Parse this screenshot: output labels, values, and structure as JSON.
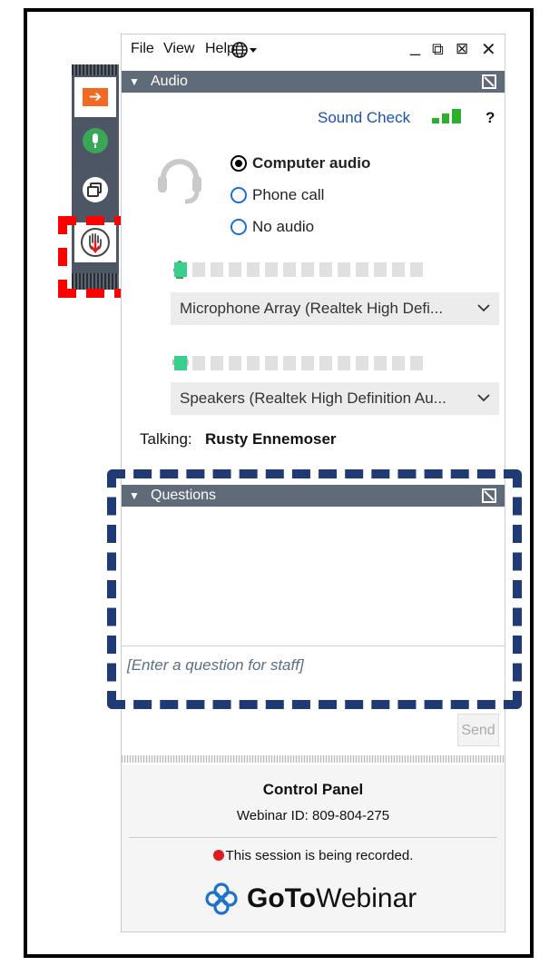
{
  "menu": {
    "file": "File",
    "view": "View",
    "help": "Help",
    "language_icon": "globe-icon",
    "minimize": "_",
    "restore": "⧉",
    "popout": "⊠",
    "close": "✕"
  },
  "grab_tab": {
    "buttons": [
      "arrow-icon",
      "microphone-icon",
      "screen-icon",
      "raise-hand-icon"
    ]
  },
  "audio": {
    "header": "Audio",
    "sound_check": "Sound Check",
    "help": "?",
    "options": [
      {
        "label": "Computer audio",
        "selected": true
      },
      {
        "label": "Phone call",
        "selected": false
      },
      {
        "label": "No audio",
        "selected": false
      }
    ],
    "mic_level_cells_on": 1,
    "mic_level_cells_total": 14,
    "microphone": "Microphone Array (Realtek High Defi...",
    "speaker_level_cells_on": 1,
    "speaker_level_cells_total": 14,
    "speakers": "Speakers (Realtek High Definition Au...",
    "talking_label": "Talking:",
    "talking_name": "Rusty Ennemoser"
  },
  "questions": {
    "header": "Questions",
    "placeholder": "[Enter a question for staff]",
    "send": "Send"
  },
  "footer": {
    "title": "Control Panel",
    "webinar_id": "Webinar ID: 809-804-275",
    "recording": "This session is being recorded.",
    "logo_bold": "GoTo",
    "logo_rest": "Webinar"
  },
  "colors": {
    "header_bg": "#5f6b78",
    "accent_orange": "#f26a21",
    "mic_green": "#3aa657",
    "level_green": "#3bcf8e",
    "link_blue": "#1a4fb4",
    "highlight_red": "#ff0000",
    "highlight_navy": "#1f3a75"
  }
}
